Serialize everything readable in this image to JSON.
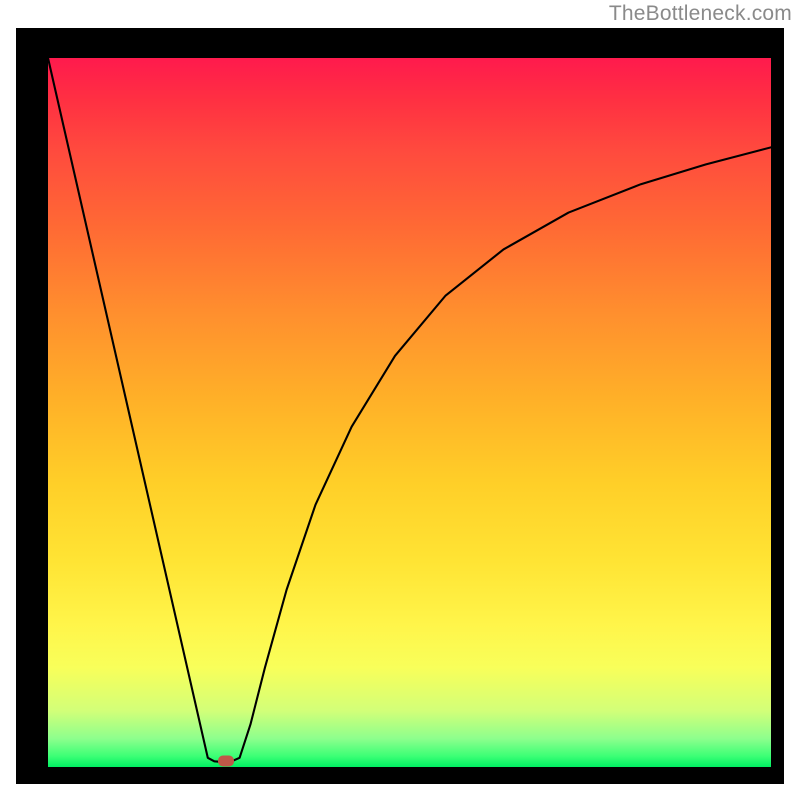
{
  "watermark": {
    "text": "TheBottleneck.com"
  },
  "colors": {
    "frame": "#000000",
    "curve": "#000000",
    "marker": "#c05848",
    "watermark": "#8a8a8a"
  },
  "chart_data": {
    "type": "line",
    "title": "",
    "xlabel": "",
    "ylabel": "",
    "xlim": [
      0,
      100
    ],
    "ylim": [
      0,
      100
    ],
    "grid": false,
    "legend": false,
    "background_gradient": {
      "orientation": "vertical",
      "stops": [
        {
          "pos": 0.0,
          "color": "#ff1a4d"
        },
        {
          "pos": 0.25,
          "color": "#ff7a30"
        },
        {
          "pos": 0.55,
          "color": "#ffc828"
        },
        {
          "pos": 0.82,
          "color": "#f6ff52"
        },
        {
          "pos": 0.95,
          "color": "#9cff85"
        },
        {
          "pos": 1.0,
          "color": "#00ef62"
        }
      ]
    },
    "series": [
      {
        "name": "left-slope",
        "x": [
          0.0,
          22.1
        ],
        "values": [
          100.0,
          1.3
        ]
      },
      {
        "name": "valley-floor",
        "x": [
          22.1,
          23.0,
          24.2,
          25.4,
          26.5
        ],
        "values": [
          1.3,
          0.8,
          0.7,
          0.8,
          1.3
        ]
      },
      {
        "name": "right-curve",
        "x": [
          26.5,
          28.0,
          30.0,
          33.0,
          37.0,
          42.0,
          48.0,
          55.0,
          63.0,
          72.0,
          82.0,
          91.0,
          100.0
        ],
        "values": [
          1.3,
          6.0,
          14.0,
          25.0,
          37.0,
          48.0,
          58.0,
          66.5,
          73.0,
          78.2,
          82.2,
          85.0,
          87.4
        ]
      }
    ],
    "marker": {
      "x": 24.6,
      "y": 0.9,
      "shape": "rounded-rect",
      "color": "#c05848"
    }
  }
}
